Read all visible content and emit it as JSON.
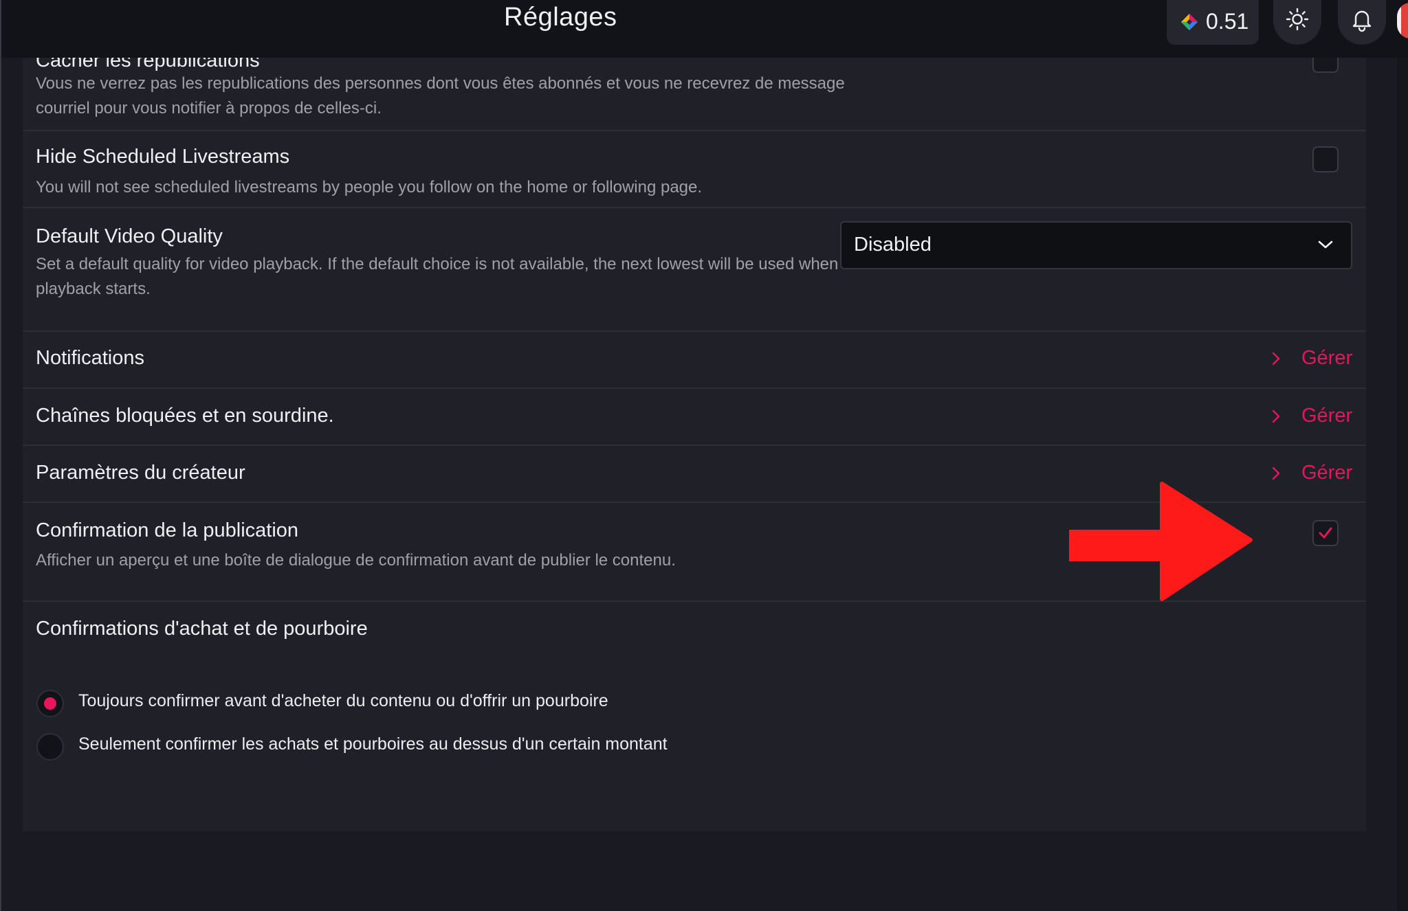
{
  "header": {
    "title": "Réglages",
    "credits": "0.51"
  },
  "settings": {
    "hide_reposts": {
      "title": "Cacher les republications",
      "description": "Vous ne verrez pas les republications des personnes dont vous êtes abonnés et vous ne recevrez de message courriel pour vous notifier à propos de celles-ci.",
      "checked": false
    },
    "hide_livestreams": {
      "title": "Hide Scheduled Livestreams",
      "description": "You will not see scheduled livestreams by people you follow on the home or following page.",
      "checked": false
    },
    "video_quality": {
      "title": "Default Video Quality",
      "description": "Set a default quality for video playback. If the default choice is not available, the next lowest will be used when playback starts.",
      "selected": "Disabled"
    },
    "notifications": {
      "title": "Notifications",
      "action": "Gérer"
    },
    "blocked": {
      "title": "Chaînes bloquées et en sourdine.",
      "action": "Gérer"
    },
    "creator": {
      "title": "Paramètres du créateur",
      "action": "Gérer"
    },
    "publish_confirm": {
      "title": "Confirmation de la publication",
      "description": "Afficher un aperçu et une boîte de dialogue de confirmation avant de publier le contenu.",
      "checked": true
    },
    "purchase_confirm": {
      "title": "Confirmations d'achat et de pourboire",
      "options": [
        {
          "label": "Toujours confirmer avant d'acheter du contenu ou d'offrir un pourboire",
          "selected": true
        },
        {
          "label": "Seulement confirmer les achats et pourboires au dessus d'un certain montant",
          "selected": false
        }
      ]
    }
  },
  "colors": {
    "accent": "#e6165a",
    "annotation_arrow": "#ff1a1a",
    "background": "#191a22",
    "card": "#1f2028"
  },
  "icons": [
    "credits-icon",
    "sun-icon",
    "bell-icon",
    "chevron-down-icon",
    "chevron-right-icon",
    "check-icon"
  ]
}
